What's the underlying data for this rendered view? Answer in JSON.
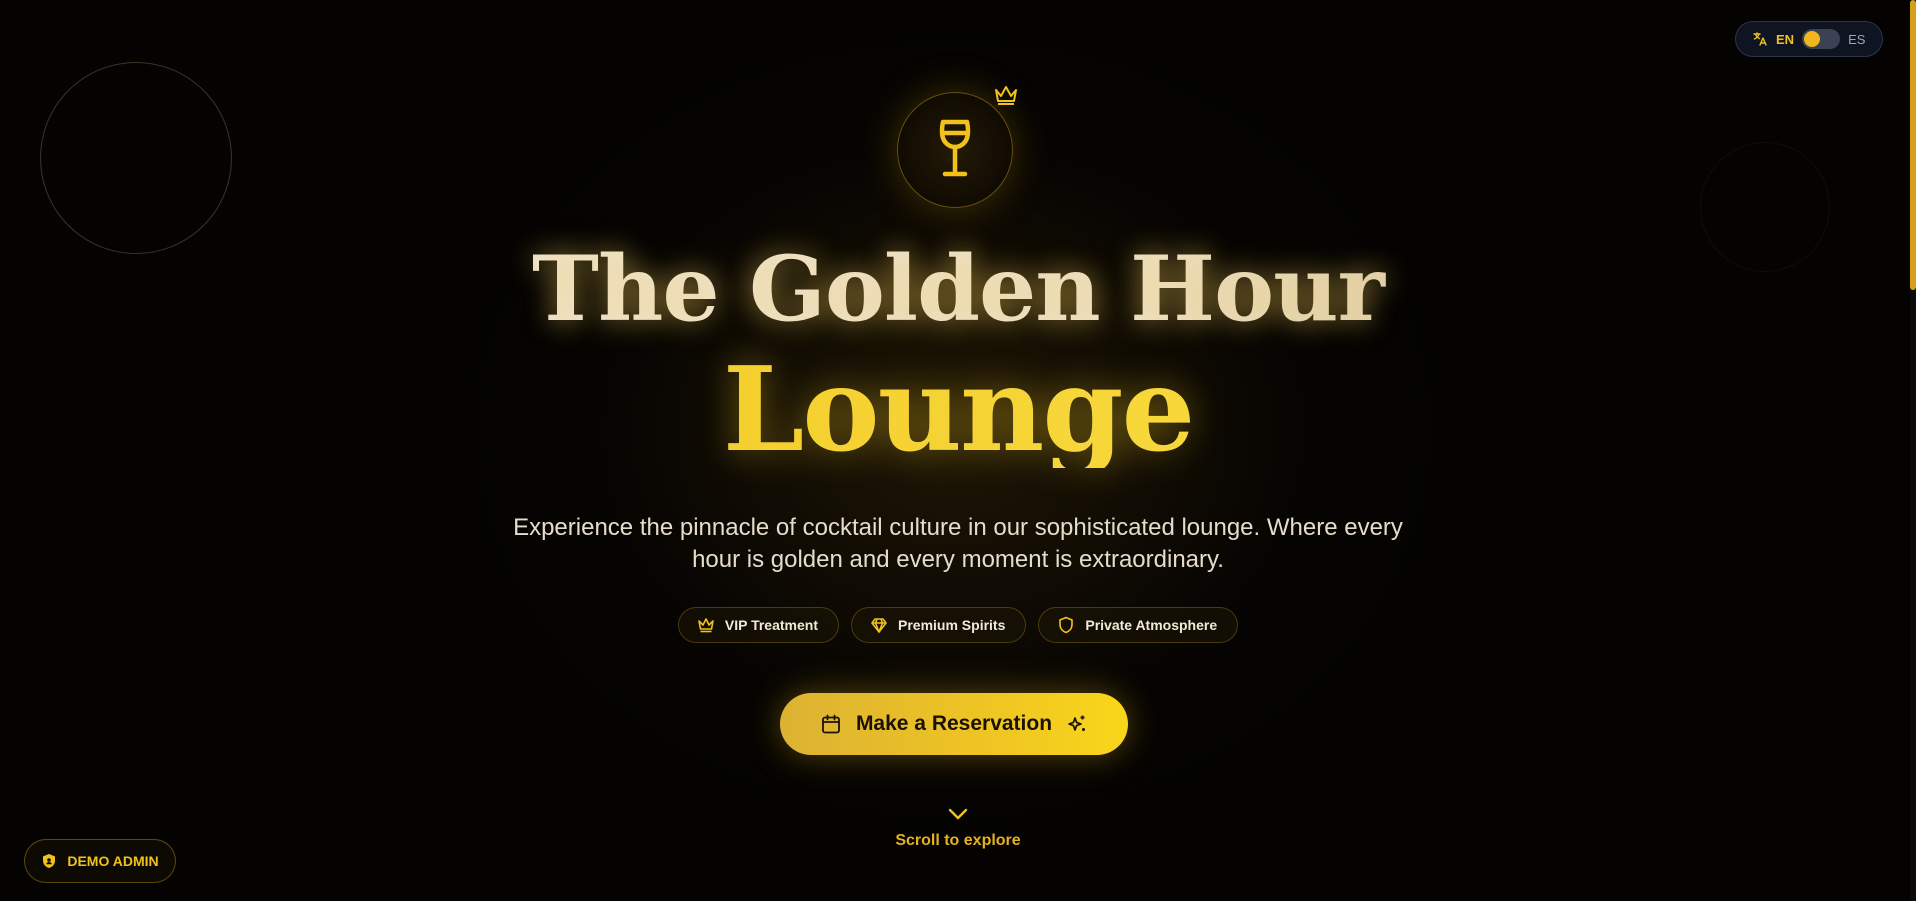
{
  "language": {
    "current": "EN",
    "alternate": "ES",
    "icon": "translate-icon"
  },
  "hero": {
    "logo_icon": "wine-glass-icon",
    "badge_icon": "crown-icon",
    "title_line1": "The Golden Hour",
    "title_line2": "Lounge",
    "subtitle": "Experience the pinnacle of cocktail culture in our sophisticated lounge. Where every hour is golden and every moment is extraordinary."
  },
  "features": [
    {
      "label": "VIP Treatment",
      "icon": "crown-icon"
    },
    {
      "label": "Premium Spirits",
      "icon": "diamond-icon"
    },
    {
      "label": "Private Atmosphere",
      "icon": "shield-icon"
    }
  ],
  "cta": {
    "label": "Make a Reservation",
    "icon_left": "calendar-icon",
    "icon_right": "sparkles-icon"
  },
  "scroll_hint": {
    "label": "Scroll to explore",
    "icon": "chevron-down-icon"
  },
  "admin": {
    "label": "DEMO ADMIN",
    "icon": "shield-icon"
  },
  "colors": {
    "accent": "#f0c21a",
    "background": "#040302",
    "title_light": "#eadfc6",
    "toggle_bg": "#0f1422"
  }
}
